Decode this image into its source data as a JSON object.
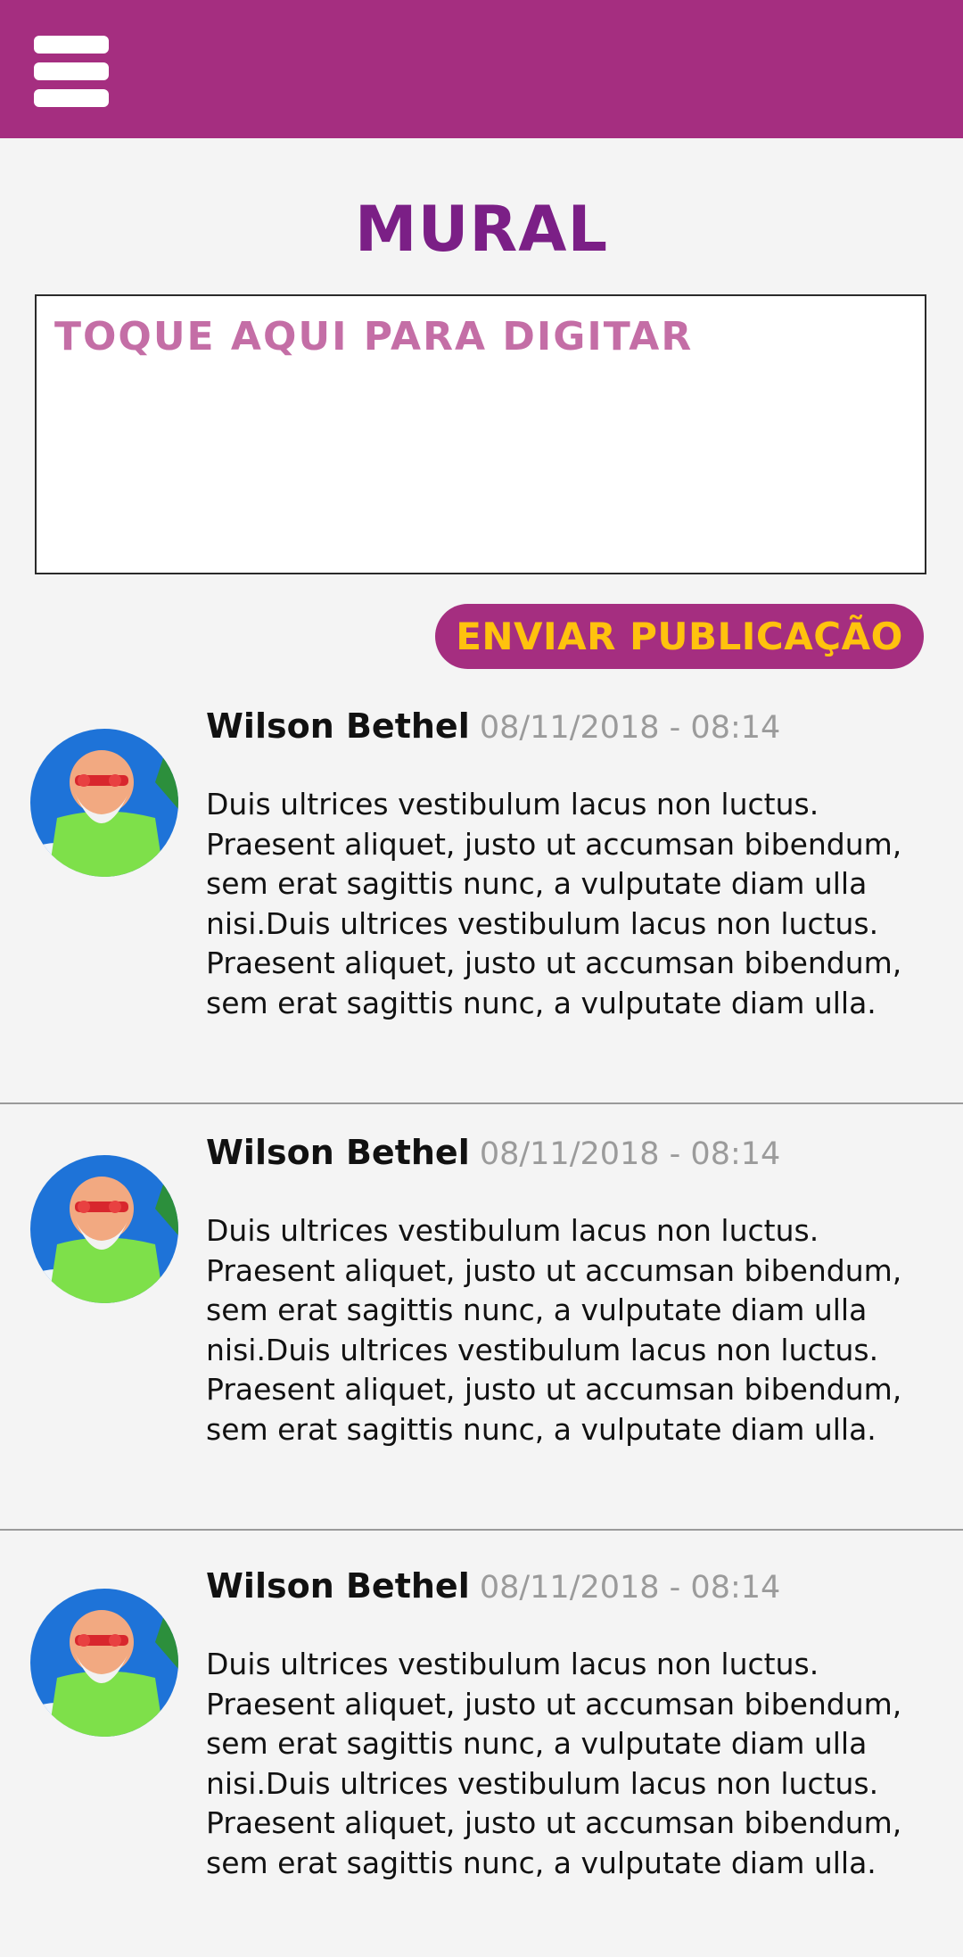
{
  "header": {
    "menu_icon": "hamburger-menu-icon",
    "color": "#a52e80"
  },
  "page": {
    "title": "MURAL",
    "title_color": "#7b1f86"
  },
  "composer": {
    "placeholder": "TOQUE AQUI PARA DIGITAR",
    "value": ""
  },
  "actions": {
    "send_label": "ENVIAR PUBLICAÇÃO",
    "send_text_color": "#ffc20e"
  },
  "posts": [
    {
      "author": "Wilson Bethel",
      "timestamp": "08/11/2018 - 08:14",
      "text": "Duis ultrices vestibulum lacus non luctus. Praesent aliquet, justo ut accumsan bibendum, sem erat sagittis nunc, a vulputate diam ulla nisi.Duis ultrices vestibulum lacus non luctus. Praesent aliquet, justo ut accumsan bibendum, sem erat sagittis nunc, a vulputate diam ulla.",
      "avatar_icon": "user-avatar"
    },
    {
      "author": "Wilson Bethel",
      "timestamp": "08/11/2018 - 08:14",
      "text": "Duis ultrices vestibulum lacus non luctus. Praesent aliquet, justo ut accumsan bibendum, sem erat sagittis nunc, a vulputate diam ulla nisi.Duis ultrices vestibulum lacus non luctus. Praesent aliquet, justo ut accumsan bibendum, sem erat sagittis nunc, a vulputate diam ulla.",
      "avatar_icon": "user-avatar"
    },
    {
      "author": "Wilson Bethel",
      "timestamp": "08/11/2018 - 08:14",
      "text": "Duis ultrices vestibulum lacus non luctus. Praesent aliquet, justo ut accumsan bibendum, sem erat sagittis nunc, a vulputate diam ulla nisi.Duis ultrices vestibulum lacus non luctus. Praesent aliquet, justo ut accumsan bibendum, sem erat sagittis nunc, a vulputate diam ulla.",
      "avatar_icon": "user-avatar"
    }
  ]
}
